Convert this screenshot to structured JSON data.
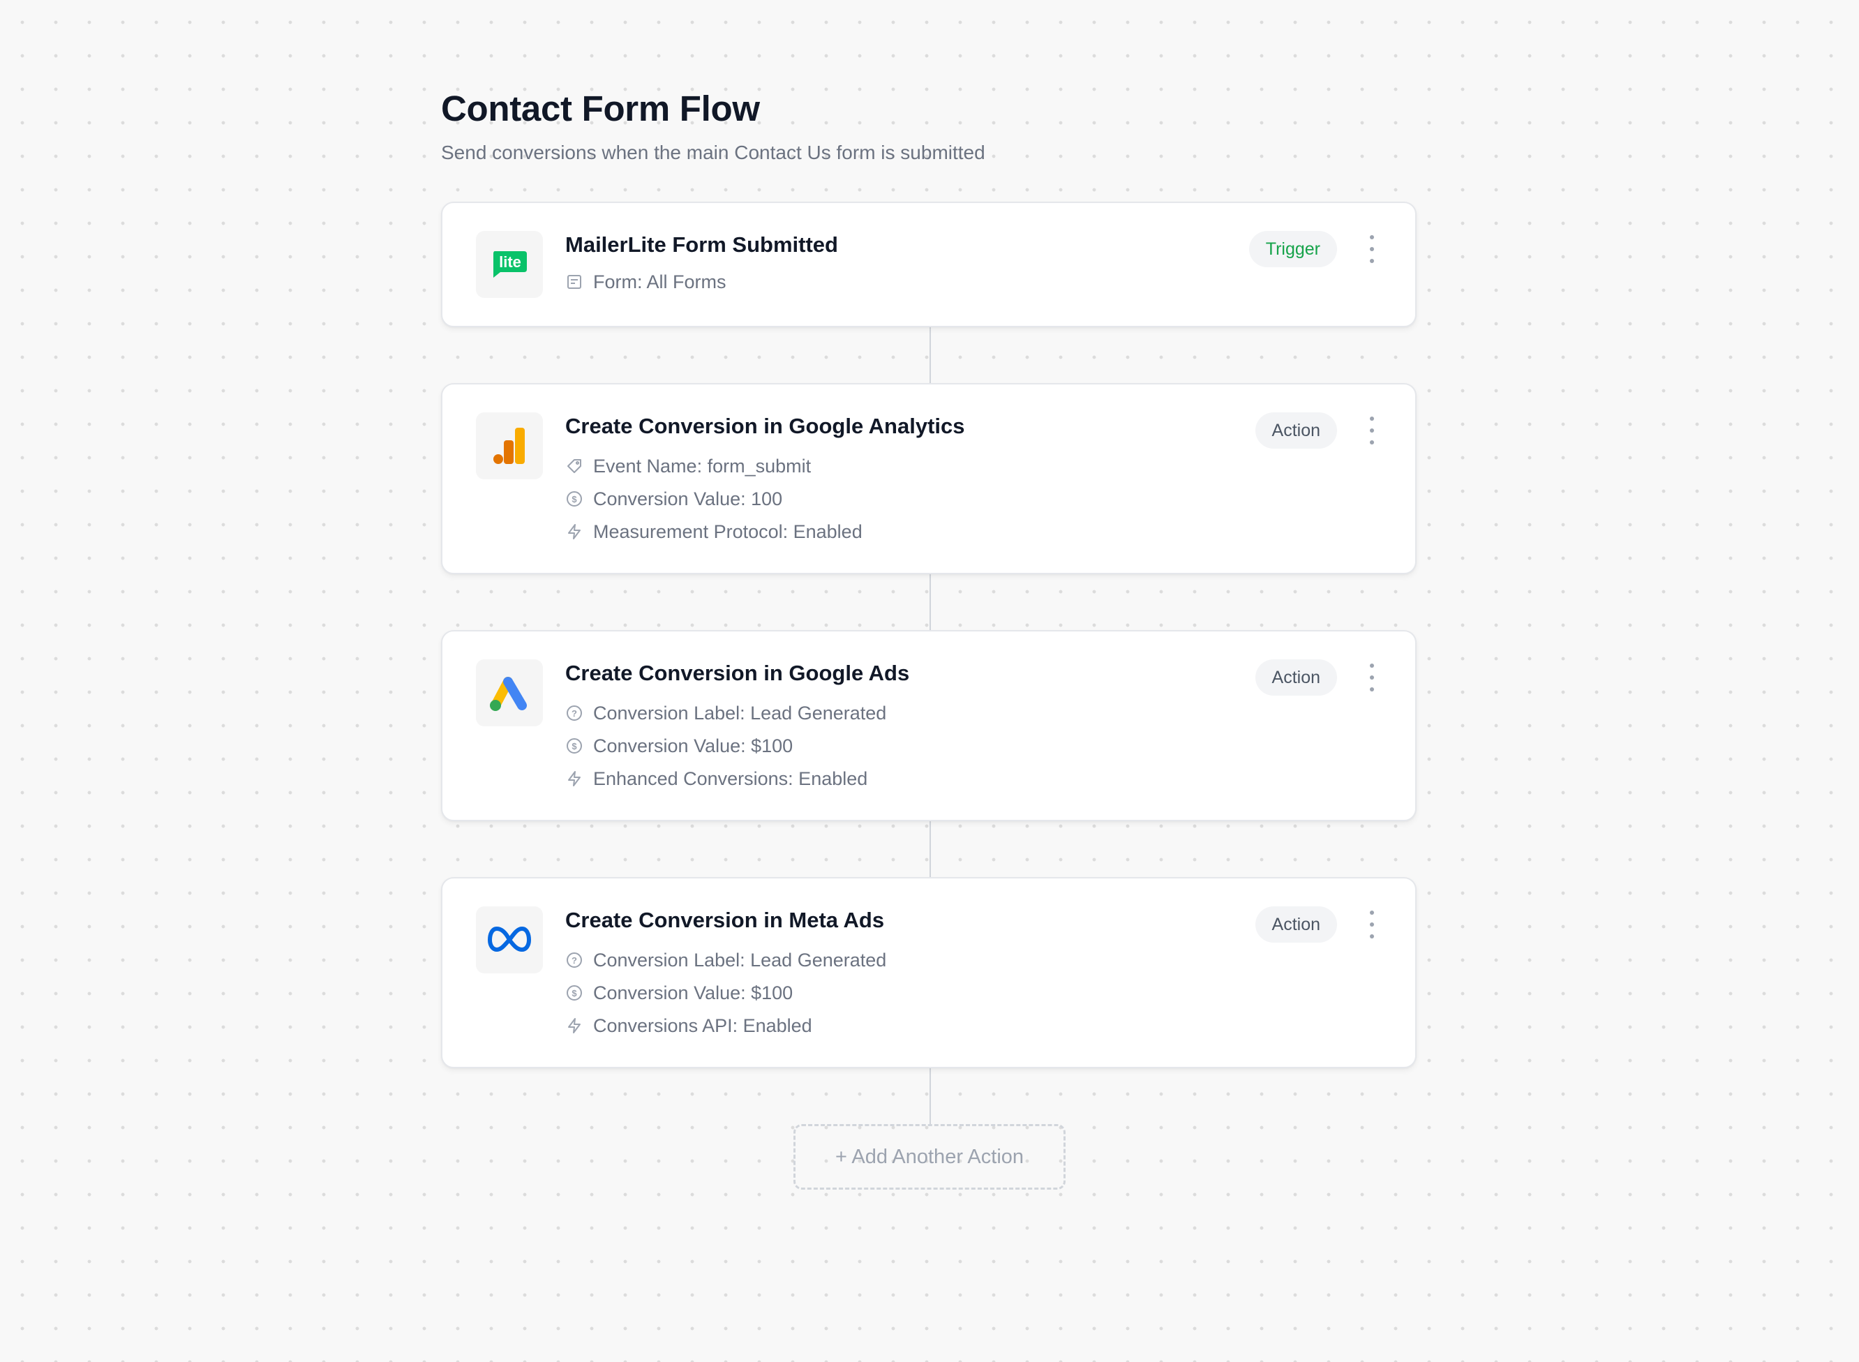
{
  "header": {
    "title": "Contact Form Flow",
    "subtitle": "Send conversions when the main Contact Us form is submitted"
  },
  "colors": {
    "trigger_green": "#16a34a",
    "mailerlite_green": "#09c269",
    "ga_orange": "#e37400",
    "ga_yellow": "#f9ab00",
    "google_blue": "#4285f4",
    "google_yellow": "#fbbc04",
    "google_green": "#34a853",
    "meta_blue": "#0668e1"
  },
  "steps": [
    {
      "title": "MailerLite Form Submitted",
      "badge": "Trigger",
      "logo_text": "lite",
      "logo_icon": "mailerlite-logo-icon",
      "details": [
        {
          "icon": "form-icon",
          "text": "Form: All Forms"
        }
      ]
    },
    {
      "title": "Create Conversion in Google Analytics",
      "badge": "Action",
      "logo_icon": "google-analytics-logo-icon",
      "details": [
        {
          "icon": "tag-icon",
          "text": "Event Name: form_submit"
        },
        {
          "icon": "dollar-icon",
          "text": "Conversion Value: 100"
        },
        {
          "icon": "lightning-icon",
          "text": "Measurement Protocol: Enabled"
        }
      ]
    },
    {
      "title": "Create Conversion in Google Ads",
      "badge": "Action",
      "logo_icon": "google-ads-logo-icon",
      "details": [
        {
          "icon": "question-circle-icon",
          "text": "Conversion Label: Lead Generated"
        },
        {
          "icon": "dollar-icon",
          "text": "Conversion Value: $100"
        },
        {
          "icon": "lightning-icon",
          "text": "Enhanced Conversions: Enabled"
        }
      ]
    },
    {
      "title": "Create Conversion in Meta Ads",
      "badge": "Action",
      "logo_icon": "meta-logo-icon",
      "details": [
        {
          "icon": "question-circle-icon",
          "text": "Conversion Label: Lead Generated"
        },
        {
          "icon": "dollar-icon",
          "text": "Conversion Value: $100"
        },
        {
          "icon": "lightning-icon",
          "text": "Conversions API: Enabled"
        }
      ]
    }
  ],
  "add_action_label": "+ Add Another Action"
}
